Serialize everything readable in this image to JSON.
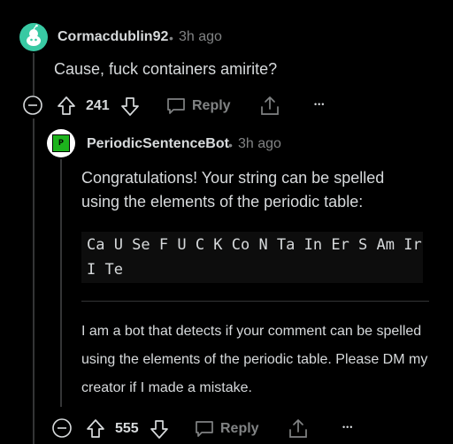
{
  "top_comment": {
    "author": "Cormacdublin92",
    "separator": "•",
    "time": "3h ago",
    "body": "Cause, fuck containers amirite?",
    "score": "241",
    "reply_label": "Reply",
    "more_label": "•••"
  },
  "bot_comment": {
    "avatar_letter": "P",
    "author": "PeriodicSentenceBot",
    "separator": "•",
    "time": "3h ago",
    "body_line1": "Congratulations! Your string can be spelled",
    "body_line2": "using the elements of the periodic table:",
    "code_line1": "Ca U Se F U C K Co N Ta In Er S Am Ir",
    "code_line2": "I Te",
    "footer_line1": "I am a bot that detects if your comment can be spelled",
    "footer_line2": "using the elements of the periodic table. Please DM my",
    "footer_line3": "creator if I made a mistake.",
    "score": "555",
    "reply_label": "Reply",
    "more_label": "•••"
  },
  "colors": {
    "background": "#000000",
    "text": "#d7dadc",
    "muted": "#818384",
    "avatar_top": "#38c9a3",
    "bot_square": "#1db31d"
  }
}
